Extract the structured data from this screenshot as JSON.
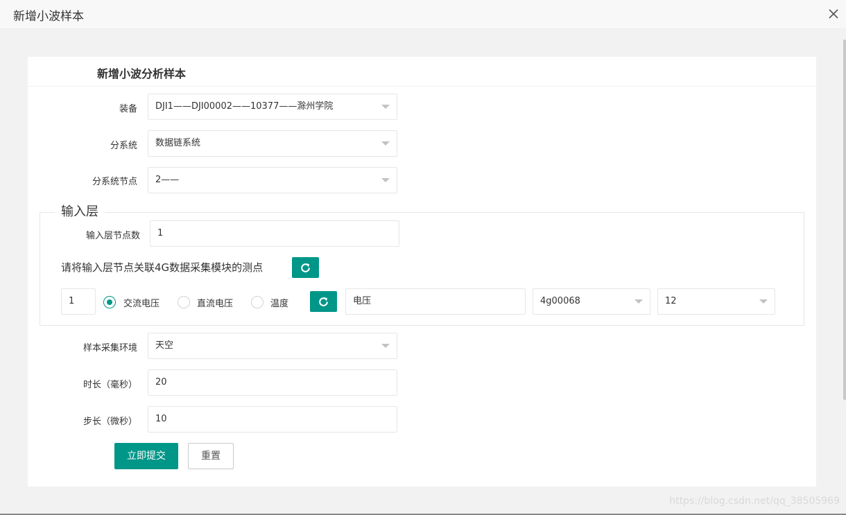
{
  "dialog": {
    "title": "新增小波样本",
    "close_icon": "close-icon"
  },
  "card": {
    "heading": "新增小波分析样本"
  },
  "form": {
    "equipment": {
      "label": "装备",
      "value": "DJI1——DJI00002——10377——滁州学院"
    },
    "subsystem": {
      "label": "分系统",
      "value": "数据链系统"
    },
    "subsystem_node": {
      "label": "分系统节点",
      "value": "2——"
    },
    "input_layer": {
      "legend": "输入层",
      "node_count": {
        "label": "输入层节点数",
        "value": "1"
      },
      "instruction": "请将输入层节点关联4G数据采集模块的测点",
      "refresh_icon": "refresh-icon",
      "row": {
        "index": "1",
        "options": [
          {
            "label": "交流电压",
            "checked": true
          },
          {
            "label": "直流电压",
            "checked": false
          },
          {
            "label": "温度",
            "checked": false
          }
        ],
        "measure": "电压",
        "module": "4g00068",
        "point": "12"
      }
    },
    "environment": {
      "label": "样本采集环境",
      "value": "天空"
    },
    "duration": {
      "label": "时长（毫秒）",
      "value": "20"
    },
    "step": {
      "label": "步长（微秒）",
      "value": "10"
    },
    "submit_label": "立即提交",
    "reset_label": "重置"
  },
  "watermark": "https://blog.csdn.net/qq_38505969",
  "colors": {
    "primary": "#009688",
    "border": "#e6e6e6"
  }
}
